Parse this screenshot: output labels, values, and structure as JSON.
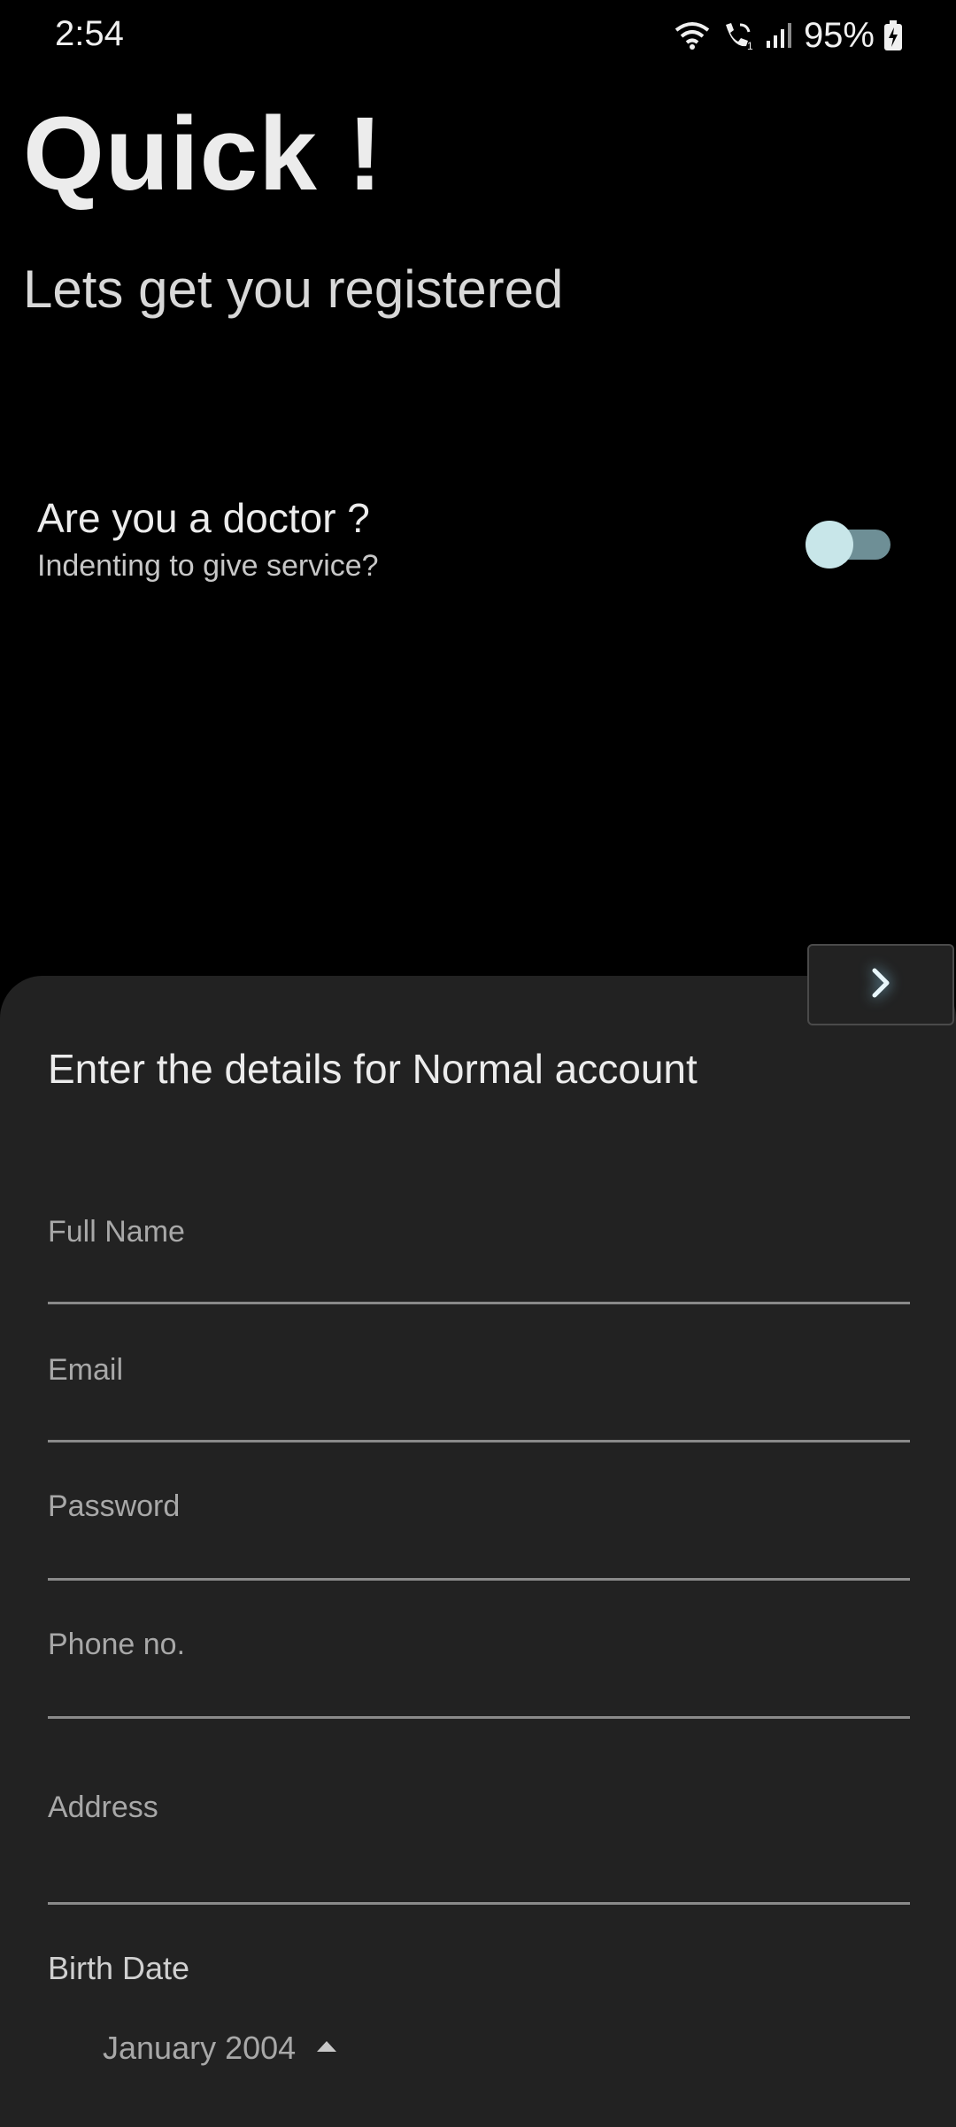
{
  "status_bar": {
    "time": "2:54",
    "battery": "95%",
    "icons": [
      "wifi-icon",
      "wifi-calling-icon",
      "signal-icon",
      "battery-charging-icon"
    ]
  },
  "header": {
    "title": "Quick !",
    "subtitle": "Lets get you registered"
  },
  "doctor_toggle": {
    "question": "Are you a doctor ?",
    "hint": "Indenting to give service?",
    "enabled": false
  },
  "form": {
    "heading": "Enter the details for Normal account",
    "next_icon": "chevron-right-icon",
    "fields": {
      "full_name": "Full Name",
      "email": "Email",
      "password": "Password",
      "phone": "Phone no.",
      "address": "Address"
    },
    "birth_date": {
      "label": "Birth Date",
      "month_year": "January 2004",
      "toggle_icon": "caret-up-icon"
    }
  },
  "colors": {
    "background": "#000000",
    "sheet": "#222222",
    "toggle_thumb": "#c8e6e9",
    "toggle_track": "#6e8f96",
    "accent_glow": "#8cd2f0"
  }
}
